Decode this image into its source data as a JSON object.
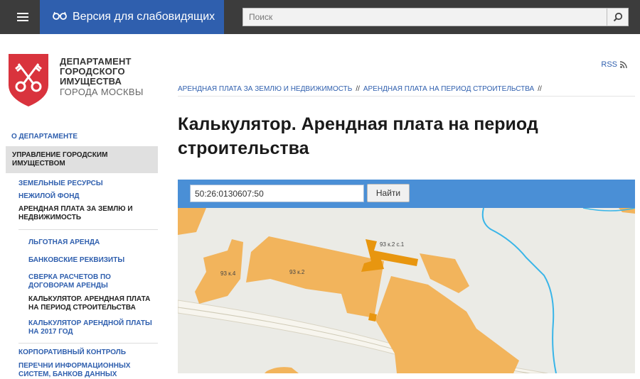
{
  "header": {
    "vision_label": "Версия для слабовидящих",
    "search_placeholder": "Поиск"
  },
  "logo": {
    "line1": "ДЕПАРТАМЕНТ",
    "line2": "ГОРОДСКОГО",
    "line3": "ИМУЩЕСТВА",
    "line4": "ГОРОДА МОСКВЫ"
  },
  "sidebar": {
    "top_item": "О ДЕПАРТАМЕНТЕ",
    "active_line1": "УПРАВЛЕНИЕ ГОРОДСКИМ",
    "active_line2": "ИМУЩЕСТВОМ",
    "items": [
      "ЗЕМЕЛЬНЫЕ РЕСУРСЫ",
      "НЕЖИЛОЙ ФОНД",
      "АРЕНДНАЯ ПЛАТА ЗА ЗЕМЛЮ И",
      "НЕДВИЖИМОСТЬ"
    ],
    "sub_items": {
      "s1": "ЛЬГОТНАЯ АРЕНДА",
      "s2": "БАНКОВСКИЕ РЕКВИЗИТЫ",
      "s3a": "СВЕРКА РАСЧЕТОВ ПО",
      "s3b": "ДОГОВОРАМ АРЕНДЫ",
      "s4a": "КАЛЬКУЛЯТОР. АРЕНДНАЯ ПЛАТА",
      "s4b": "НА ПЕРИОД СТРОИТЕЛЬСТВА",
      "s5a": "КАЛЬКУЛЯТОР АРЕНДНОЙ ПЛАТЫ",
      "s5b": "НА 2017 ГОД"
    },
    "bottom1": "КОРПОРАТИВНЫЙ КОНТРОЛЬ",
    "bottom2": "ПЕРЕЧНИ ИНФОРМАЦИОННЫХ",
    "bottom3": "СИСТЕМ, БАНКОВ ДАННЫХ"
  },
  "rss_label": "RSS",
  "breadcrumb": {
    "item1": "АРЕНДНАЯ ПЛАТА ЗА ЗЕМЛЮ И НЕДВИЖИМОСТЬ",
    "item2": "АРЕНДНАЯ ПЛАТА НА ПЕРИОД СТРОИТЕЛЬСТВА",
    "divider": "//"
  },
  "page": {
    "title_line1": "Калькулятор. Арендная плата на период",
    "title_line2": "строительства"
  },
  "calculator": {
    "cadastral_value": "50:26:0130607:50",
    "find_label": "Найти"
  },
  "map": {
    "labels": [
      "93 к.4",
      "93 к.2",
      "93 к.2 с.1"
    ]
  },
  "colors": {
    "accent": "#2f5fae",
    "topbar": "#3c3c3c",
    "logo_red": "#d9333d",
    "map_bar": "#4a8fd6",
    "building": "#f2b45c",
    "building_selected": "#e8960f",
    "river": "#39b5e8"
  }
}
